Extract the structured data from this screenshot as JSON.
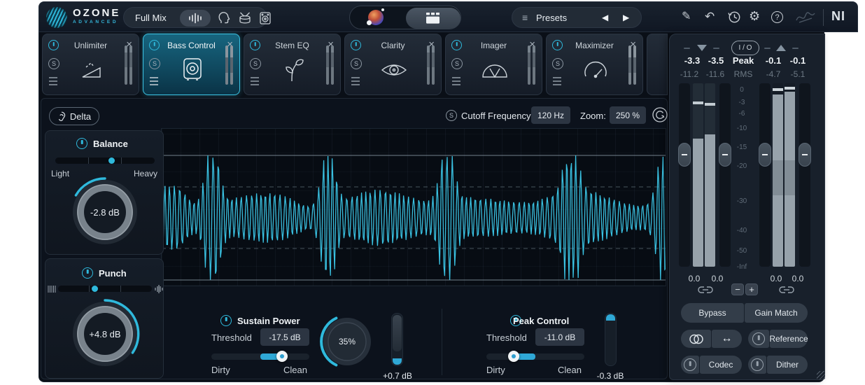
{
  "header": {
    "brand": {
      "name": "OZONE",
      "tier": "ADVANCED"
    },
    "target_label": "Full Mix",
    "presets_label": "Presets"
  },
  "glyphs": {
    "close": "×",
    "solo": "S",
    "prev": "◀",
    "next": "▶",
    "pencil": "✎",
    "undo": "↶",
    "gear": "⚙",
    "help": "?",
    "menu": "≡",
    "arrow_lr": "↔",
    "minus": "−",
    "plus": "+",
    "ni": "NI"
  },
  "modules": {
    "items": [
      {
        "name": "Unlimiter"
      },
      {
        "name": "Bass Control",
        "selected": true
      },
      {
        "name": "Stem EQ"
      },
      {
        "name": "Clarity"
      },
      {
        "name": "Imager"
      },
      {
        "name": "Maximizer"
      }
    ]
  },
  "main": {
    "delta_label": "Delta",
    "cutoff_label": "Cutoff Frequency:",
    "cutoff_value": "120 Hz",
    "zoom_label": "Zoom:",
    "zoom_value": "250 %",
    "balance": {
      "title": "Balance",
      "left": "Light",
      "right": "Heavy",
      "value": "-2.8 dB"
    },
    "punch": {
      "title": "Punch",
      "value": "+4.8 dB"
    },
    "sustain": {
      "title": "Sustain Power",
      "threshold_label": "Threshold",
      "threshold_value": "-17.5 dB",
      "left": "Dirty",
      "right": "Clean",
      "amount": "35%",
      "makeup": "+0.7 dB"
    },
    "peak": {
      "title": "Peak Control",
      "threshold_label": "Threshold",
      "threshold_value": "-11.0 dB",
      "left": "Dirty",
      "right": "Clean",
      "makeup": "-0.3 dB"
    },
    "waveform": {
      "color": "#3ac2e2",
      "bursts": [
        0.1,
        0.33,
        0.565,
        0.81,
        0.995
      ],
      "base_amp": 0.38,
      "burst_amp": 1.0
    }
  },
  "meters": {
    "io_label": "I / O",
    "peak_label": "Peak",
    "rms_label": "RMS",
    "in_peak": [
      "-3.3",
      "-3.5"
    ],
    "out_peak": [
      "-0.1",
      "-0.1"
    ],
    "in_rms": [
      "-11.2",
      "-11.6"
    ],
    "out_rms": [
      "-4.7",
      "-5.1"
    ],
    "scale": [
      "0",
      "-3",
      "-6",
      "-10",
      "-15",
      "-20",
      "-30",
      "-40",
      "-50",
      "-Inf"
    ],
    "in_gain": [
      "0.0",
      "0.0"
    ],
    "out_gain": [
      "0.0",
      "0.0"
    ],
    "bypass": "Bypass",
    "gain_match": "Gain Match",
    "reference": "Reference",
    "codec": "Codec",
    "dither": "Dither"
  }
}
